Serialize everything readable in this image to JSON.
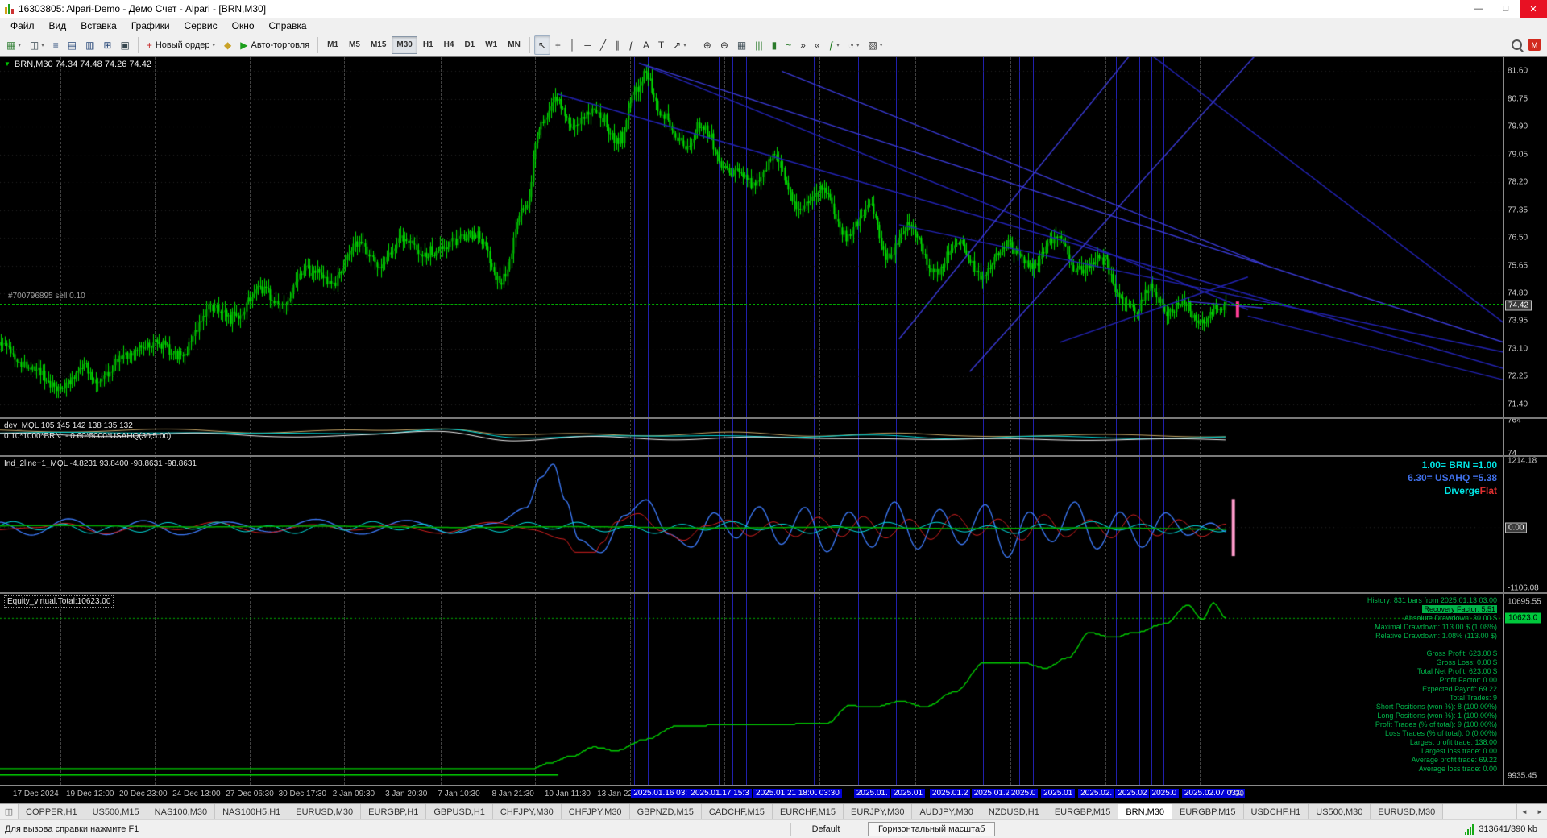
{
  "window": {
    "title": "16303805: Alpari-Demo - Демо Счет - Alpari - [BRN,M30]",
    "minimize_glyph": "—",
    "restore_glyph": "□",
    "close_glyph": "✕"
  },
  "menu": {
    "items": [
      "Файл",
      "Вид",
      "Вставка",
      "Графики",
      "Сервис",
      "Окно",
      "Справка"
    ]
  },
  "toolbar": {
    "file_group": [
      {
        "name": "new-chart",
        "glyph": "▦",
        "color": "#2e7d32",
        "dd": true
      },
      {
        "name": "profiles",
        "glyph": "◫",
        "color": "#37474f",
        "dd": true
      },
      {
        "name": "market-watch",
        "glyph": "≡",
        "color": "#2a4a7a"
      },
      {
        "name": "data-window",
        "glyph": "▤",
        "color": "#2a4a7a"
      },
      {
        "name": "navigator",
        "glyph": "▥",
        "color": "#2a4a7a"
      },
      {
        "name": "terminal",
        "glyph": "⊞",
        "color": "#2a4a7a"
      },
      {
        "name": "strategy-tester",
        "glyph": "▣",
        "color": "#37474f"
      }
    ],
    "order_group": [
      {
        "name": "new-order",
        "glyph": "+",
        "color": "#c62828",
        "label": "Новый ордер",
        "dd": true
      },
      {
        "name": "metaeditor",
        "glyph": "◆",
        "color": "#c9a227"
      },
      {
        "name": "autotrading",
        "glyph": "▶",
        "color": "#1b9e1b",
        "label": "Авто-торговля"
      }
    ],
    "tool_group": [
      {
        "name": "cursor",
        "glyph": "↖",
        "color": "#333",
        "active": true
      },
      {
        "name": "crosshair",
        "glyph": "+",
        "color": "#333"
      },
      {
        "name": "vertical-line",
        "glyph": "│",
        "color": "#333"
      },
      {
        "name": "horizontal-line",
        "glyph": "─",
        "color": "#333"
      },
      {
        "name": "trendline",
        "glyph": "╱",
        "color": "#333"
      },
      {
        "name": "equidistant-channel",
        "glyph": "∥",
        "color": "#333"
      },
      {
        "name": "fibonacci",
        "glyph": "ƒ",
        "color": "#333"
      },
      {
        "name": "text",
        "glyph": "A",
        "color": "#333"
      },
      {
        "name": "text-label",
        "glyph": "T",
        "color": "#333"
      },
      {
        "name": "arrows",
        "glyph": "↗",
        "color": "#333",
        "dd": true
      }
    ],
    "view_group": [
      {
        "name": "zoom-in",
        "glyph": "⊕",
        "color": "#333"
      },
      {
        "name": "zoom-out",
        "glyph": "⊖",
        "color": "#333"
      },
      {
        "name": "tile-windows",
        "glyph": "▦",
        "color": "#37474f"
      },
      {
        "name": "bar-chart-mode",
        "glyph": "|||",
        "color": "#2a7a2a"
      },
      {
        "name": "candlestick-mode",
        "glyph": "▮",
        "color": "#2a7a2a"
      },
      {
        "name": "line-chart-mode",
        "glyph": "~",
        "color": "#2a7a2a"
      },
      {
        "name": "auto-scroll",
        "glyph": "»",
        "color": "#333"
      },
      {
        "name": "chart-shift",
        "glyph": "«",
        "color": "#333"
      },
      {
        "name": "indicators-list",
        "glyph": "ƒ",
        "color": "#1b7a1b",
        "dd": true
      },
      {
        "name": "periods",
        "glyph": "◔",
        "color": "#333",
        "dd": true
      },
      {
        "name": "templates",
        "glyph": "▧",
        "color": "#333",
        "dd": true
      }
    ],
    "mql5_badge": "M"
  },
  "timeframes": {
    "items": [
      "M1",
      "M5",
      "M15",
      "M30",
      "H1",
      "H4",
      "D1",
      "W1",
      "MN"
    ],
    "active": "M30"
  },
  "chart": {
    "marker_glyph": "▼",
    "ohlc_label": "BRN,M30  74.34 74.48 74.26 74.42",
    "order_label": "#700796895 sell 0.10"
  },
  "panels": {
    "main": {
      "ticks": [
        81.6,
        80.75,
        79.9,
        79.05,
        78.2,
        77.35,
        76.5,
        75.65,
        74.8,
        73.95,
        73.1,
        72.25,
        71.4
      ],
      "current": "74.42"
    },
    "spread": {
      "label_line1": "dev_MQL 105 145 142 138 135 132",
      "label_line2": "0.10*1000*BRN: - 0.60*5000*USAHQ(30,5.00)",
      "ticks": [
        {
          "v": 764,
          "text": "764"
        },
        {
          "v": 74,
          "text": "74"
        }
      ]
    },
    "oscillator": {
      "label": "Ind_2line+1_MQL -4.8231 93.8400 -98.8631 -98.8631",
      "ticks": [
        {
          "v": 1214.18,
          "text": "1214.18"
        },
        {
          "v": 0,
          "text": "0.00",
          "badge": "dark"
        },
        {
          "v": -1106.08,
          "text": "-1106.08"
        }
      ],
      "right_lines": [
        {
          "text": "1.00= BRN =1.00",
          "color": "#00E5E5"
        },
        {
          "text": "6.30= USAHQ =5.38",
          "color": "#3F6FE8"
        }
      ],
      "right_parts": [
        {
          "text": "Diverge",
          "color": "#00E5E5"
        },
        {
          "text": "Flat",
          "color": "#E03030"
        }
      ]
    },
    "equity": {
      "label": "Equity_virtual.Total:10623.00",
      "ticks": [
        {
          "v": 10695.55,
          "text": "10695.55"
        },
        {
          "v": 10623.0,
          "text": "10623.0",
          "badge": "green"
        },
        {
          "v": 9935.45,
          "text": "9935.45"
        }
      ],
      "stats": [
        {
          "text": "History: 831 bars from 2025.01.13 03:00"
        },
        {
          "text": "Recovery Factor: 5.51",
          "hl": true
        },
        {
          "text": "Absolute Drawdown: 30.00 $"
        },
        {
          "text": "Maximal Drawdown: 113.00 $ (1.08%)"
        },
        {
          "text": "Relative Drawdown: 1.08% (113.00 $)"
        },
        {
          "text": ""
        },
        {
          "text": "Gross Profit: 623.00 $"
        },
        {
          "text": "Gross Loss: 0.00 $"
        },
        {
          "text": "Total Net Profit: 623.00 $"
        },
        {
          "text": "Profit Factor: 0.00"
        },
        {
          "text": "Expected Payoff: 69.22"
        },
        {
          "text": "Total Trades: 9"
        },
        {
          "text": "Short Positions (won %): 8 (100.00%)"
        },
        {
          "text": "Long Positions (won %): 1 (100.00%)"
        },
        {
          "text": "Profit Trades (% of total): 9 (100.00%)"
        },
        {
          "text": "Loss Trades (% of total): 0 (0.00%)"
        },
        {
          "text": "Largest profit trade: 138.00"
        },
        {
          "text": "Largest loss trade: 0.00"
        },
        {
          "text": "Average profit trade: 69.22"
        },
        {
          "text": "Average loss trade: 0.00"
        }
      ]
    }
  },
  "time_axis": {
    "labels": [
      {
        "text": "17 Dec 2024",
        "x": 0.0083
      },
      {
        "text": "19 Dec 12:00",
        "x": 0.0427
      },
      {
        "text": "20 Dec 23:00",
        "x": 0.0771
      },
      {
        "text": "24 Dec 13:00",
        "x": 0.1115
      },
      {
        "text": "27 Dec 06:30",
        "x": 0.146
      },
      {
        "text": "30 Dec 17:30",
        "x": 0.18
      },
      {
        "text": "2 Jan 09:30",
        "x": 0.215
      },
      {
        "text": "3 Jan 20:30",
        "x": 0.249
      },
      {
        "text": "7 Jan 10:30",
        "x": 0.283
      },
      {
        "text": "8 Jan 21:30",
        "x": 0.318
      },
      {
        "text": "10 Jan 11:30",
        "x": 0.352
      },
      {
        "text": "13 Jan 22:3",
        "x": 0.386
      },
      {
        "text": "2025.01.16 03:",
        "x": 0.408,
        "hl": true
      },
      {
        "text": "2025.01.17 15:3",
        "x": 0.445,
        "hl": true
      },
      {
        "text": "2025.01.21 18:00",
        "x": 0.487,
        "hl": true
      },
      {
        "text": "03:30",
        "x": 0.528,
        "hl": true
      },
      {
        "text": "2025.01.",
        "x": 0.552,
        "hl": true
      },
      {
        "text": "2025.01",
        "x": 0.576,
        "hl": true
      },
      {
        "text": "2025.01.2",
        "x": 0.601,
        "hl": true
      },
      {
        "text": "2025.01.2",
        "x": 0.628,
        "hl": true
      },
      {
        "text": "2025.0",
        "x": 0.652,
        "hl": true
      },
      {
        "text": "2025.01",
        "x": 0.673,
        "hl": true
      },
      {
        "text": "2025.02.",
        "x": 0.697,
        "hl": true
      },
      {
        "text": "2025.02",
        "x": 0.721,
        "hl": true
      },
      {
        "text": "2025.0",
        "x": 0.743,
        "hl": true
      },
      {
        "text": "2025.02.07 03:0",
        "x": 0.764,
        "hl": true
      },
      {
        "text": "7:30",
        "x": 0.794
      }
    ]
  },
  "tabs": {
    "left_icon": "◫",
    "scroll_left": "◄",
    "scroll_right": "►",
    "active_index": 16,
    "items": [
      "COPPER,H1",
      "US500,M15",
      "NAS100,M30",
      "NAS100H5,H1",
      "EURUSD,M30",
      "EURGBP,H1",
      "GBPUSD,H1",
      "CHFJPY,M30",
      "CHFJPY,M30",
      "GBPNZD,M15",
      "CADCHF,M15",
      "EURCHF,M15",
      "EURJPY,M30",
      "AUDJPY,M30",
      "NZDUSD,H1",
      "EURGBP,M15",
      "BRN,M30",
      "EURGBP,M15",
      "USDCHF,H1",
      "US500,M30",
      "EURUSD,M30"
    ]
  },
  "status": {
    "help_text": "Для вызова справки нажмите F1",
    "profile": "Default",
    "hint": "Горизонтальный масштаб",
    "traffic": "313641/390 kb"
  },
  "chart_data": {
    "type": "candlestick",
    "symbol": "BRN",
    "timeframe": "M30",
    "main": {
      "ymin": 71.0,
      "ymax": 82.03,
      "candles": 620,
      "data_span": 0.816,
      "current_price": 74.42,
      "sell_line": {
        "price": 74.48
      },
      "price_anchors": [
        [
          0,
          73.3
        ],
        [
          0.02,
          72.6
        ],
        [
          0.05,
          71.9
        ],
        [
          0.067,
          72.6
        ],
        [
          0.08,
          72.1
        ],
        [
          0.1,
          72.9
        ],
        [
          0.126,
          73.3
        ],
        [
          0.146,
          72.9
        ],
        [
          0.172,
          74.4
        ],
        [
          0.191,
          74.1
        ],
        [
          0.211,
          74.9
        ],
        [
          0.231,
          74.5
        ],
        [
          0.25,
          75.6
        ],
        [
          0.27,
          75.1
        ],
        [
          0.29,
          76.3
        ],
        [
          0.31,
          75.7
        ],
        [
          0.329,
          76.5
        ],
        [
          0.349,
          75.9
        ],
        [
          0.369,
          76.4
        ],
        [
          0.388,
          76.6
        ],
        [
          0.408,
          75.2
        ],
        [
          0.428,
          77.5
        ],
        [
          0.441,
          80.0
        ],
        [
          0.454,
          80.7
        ],
        [
          0.467,
          79.9
        ],
        [
          0.483,
          80.4
        ],
        [
          0.503,
          79.5
        ],
        [
          0.519,
          81.0
        ],
        [
          0.526,
          81.55
        ],
        [
          0.539,
          80.3
        ],
        [
          0.559,
          79.3
        ],
        [
          0.572,
          80.0
        ],
        [
          0.591,
          78.6
        ],
        [
          0.618,
          78.2
        ],
        [
          0.631,
          79.0
        ],
        [
          0.65,
          77.4
        ],
        [
          0.67,
          78.0
        ],
        [
          0.69,
          76.6
        ],
        [
          0.71,
          77.5
        ],
        [
          0.723,
          75.9
        ],
        [
          0.742,
          76.9
        ],
        [
          0.762,
          75.4
        ],
        [
          0.781,
          76.4
        ],
        [
          0.801,
          75.3
        ],
        [
          0.821,
          76.3
        ],
        [
          0.841,
          75.6
        ],
        [
          0.861,
          76.5
        ],
        [
          0.88,
          75.5
        ],
        [
          0.9,
          75.9
        ],
        [
          0.913,
          74.6
        ],
        [
          0.926,
          74.3
        ],
        [
          0.939,
          75.0
        ],
        [
          0.952,
          74.2
        ],
        [
          0.965,
          74.6
        ],
        [
          0.978,
          73.9
        ],
        [
          0.991,
          74.3
        ],
        [
          1,
          74.42
        ]
      ],
      "trend_lines": [
        [
          0.371,
          80.9,
          1.0,
          72.5
        ],
        [
          0.425,
          81.85,
          1.0,
          73.3
        ],
        [
          0.425,
          81.85,
          0.83,
          74.3
        ],
        [
          0.598,
          73.4,
          0.757,
          82.4
        ],
        [
          0.757,
          82.4,
          1.0,
          73.9
        ],
        [
          0.645,
          72.4,
          0.845,
          82.6
        ],
        [
          0.598,
          76.9,
          1.0,
          73.0
        ],
        [
          0.52,
          81.6,
          0.84,
          75.7
        ],
        [
          0.83,
          74.1,
          1.0,
          72.15
        ],
        [
          0.79,
          74.55,
          0.84,
          74.35
        ],
        [
          0.705,
          73.3,
          0.83,
          75.3
        ]
      ]
    },
    "vertical_lines": {
      "gray": [
        0.04,
        0.103,
        0.166,
        0.229,
        0.293,
        0.356,
        0.419,
        0.482,
        0.545,
        0.609,
        0.672,
        0.735,
        0.798
      ],
      "blue": [
        0.422,
        0.431,
        0.478,
        0.487,
        0.496,
        0.541,
        0.55,
        0.571,
        0.596,
        0.605,
        0.63,
        0.654,
        0.678,
        0.687,
        0.71,
        0.718,
        0.742,
        0.758,
        0.766,
        0.774,
        0.801,
        0.809
      ]
    },
    "spread_panel": {
      "colors": [
        "#C8A868",
        "#00E0E0",
        "#F0F0F0"
      ],
      "anchors": [
        [
          0,
          0.36
        ],
        [
          0.08,
          0.4
        ],
        [
          0.15,
          0.35
        ],
        [
          0.22,
          0.42
        ],
        [
          0.3,
          0.38
        ],
        [
          0.36,
          0.3
        ],
        [
          0.42,
          0.52
        ],
        [
          0.48,
          0.45
        ],
        [
          0.54,
          0.5
        ],
        [
          0.6,
          0.44
        ],
        [
          0.66,
          0.5
        ],
        [
          0.72,
          0.46
        ],
        [
          0.78,
          0.52
        ],
        [
          0.85,
          0.5
        ],
        [
          1,
          0.52
        ]
      ],
      "scale": {
        "ymin": 40,
        "ymax": 800
      }
    },
    "oscillator_panel": {
      "ymin": -1180,
      "ymax": 1290,
      "blue_anchors": [
        [
          0,
          80
        ],
        [
          0.025,
          -120
        ],
        [
          0.055,
          150
        ],
        [
          0.086,
          -130
        ],
        [
          0.116,
          140
        ],
        [
          0.147,
          -150
        ],
        [
          0.184,
          120
        ],
        [
          0.221,
          -100
        ],
        [
          0.257,
          170
        ],
        [
          0.294,
          -140
        ],
        [
          0.331,
          150
        ],
        [
          0.368,
          -120
        ],
        [
          0.404,
          100
        ],
        [
          0.429,
          350
        ],
        [
          0.441,
          900
        ],
        [
          0.451,
          1150
        ],
        [
          0.461,
          500
        ],
        [
          0.472,
          -200
        ],
        [
          0.49,
          -450
        ],
        [
          0.509,
          200
        ],
        [
          0.527,
          500
        ],
        [
          0.545,
          -100
        ],
        [
          0.564,
          -350
        ],
        [
          0.582,
          250
        ],
        [
          0.6,
          -200
        ],
        [
          0.619,
          400
        ],
        [
          0.637,
          -300
        ],
        [
          0.656,
          350
        ],
        [
          0.674,
          -450
        ],
        [
          0.692,
          300
        ],
        [
          0.711,
          -350
        ],
        [
          0.729,
          450
        ],
        [
          0.748,
          -400
        ],
        [
          0.766,
          350
        ],
        [
          0.784,
          -300
        ],
        [
          0.803,
          400
        ],
        [
          0.821,
          -550
        ],
        [
          0.839,
          300
        ],
        [
          0.858,
          -250
        ],
        [
          0.876,
          450
        ],
        [
          0.894,
          -400
        ],
        [
          0.913,
          300
        ],
        [
          0.931,
          -350
        ],
        [
          0.95,
          250
        ],
        [
          0.968,
          -150
        ],
        [
          0.987,
          100
        ],
        [
          1,
          -60
        ]
      ]
    },
    "equity_panel": {
      "ymin": 9895,
      "ymax": 10730,
      "current": 10623,
      "baseline": {
        "value": 9938,
        "to": 0.455
      },
      "anchors": [
        [
          0,
          9968
        ],
        [
          0.435,
          9968
        ],
        [
          0.447,
          9990
        ],
        [
          0.466,
          10020
        ],
        [
          0.484,
          10060
        ],
        [
          0.502,
          10045
        ],
        [
          0.527,
          10095
        ],
        [
          0.551,
          10150
        ],
        [
          0.576,
          10155
        ],
        [
          0.637,
          10160
        ],
        [
          0.674,
          10165
        ],
        [
          0.692,
          10240
        ],
        [
          0.711,
          10235
        ],
        [
          0.735,
          10260
        ],
        [
          0.754,
          10235
        ],
        [
          0.778,
          10300
        ],
        [
          0.803,
          10430
        ],
        [
          0.833,
          10430
        ],
        [
          0.852,
          10405
        ],
        [
          0.87,
          10450
        ],
        [
          0.888,
          10560
        ],
        [
          0.907,
          10540
        ],
        [
          0.925,
          10560
        ],
        [
          0.95,
          10600
        ],
        [
          0.968,
          10680
        ],
        [
          0.98,
          10620
        ],
        [
          0.989,
          10690
        ],
        [
          1,
          10623
        ]
      ]
    }
  }
}
